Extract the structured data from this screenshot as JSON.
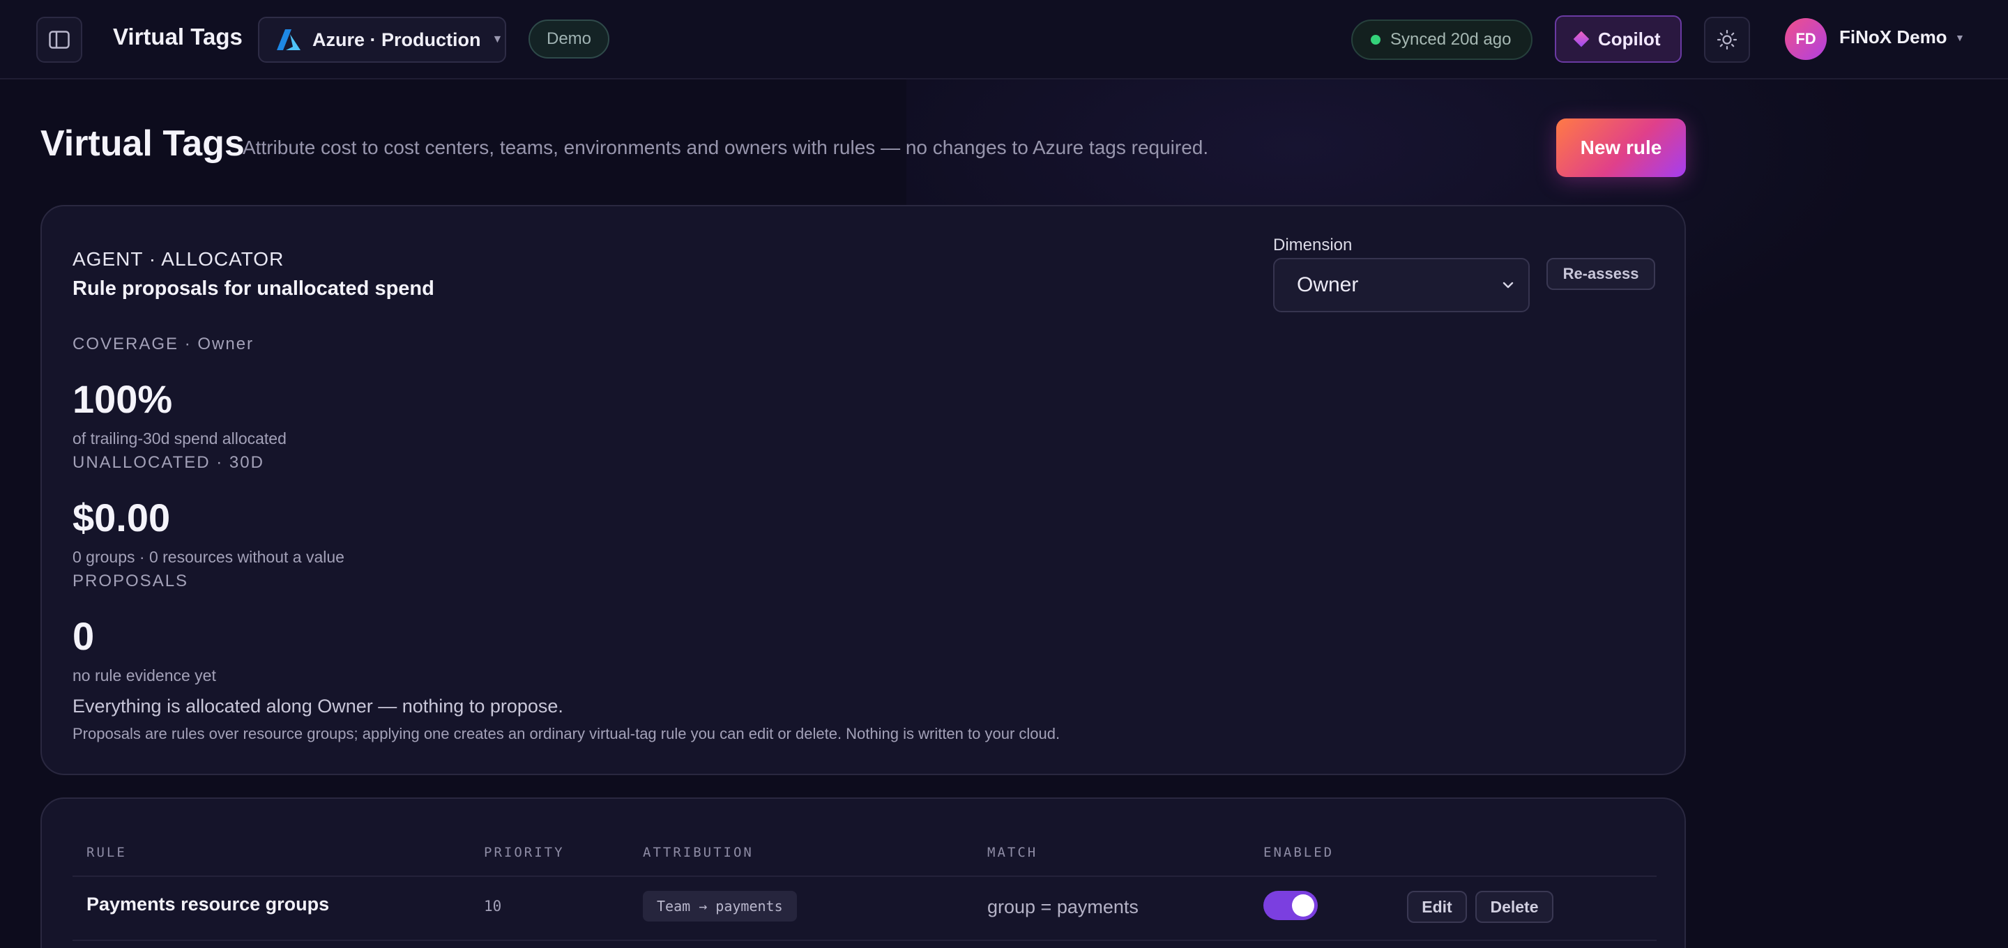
{
  "topbar": {
    "app_title": "Virtual Tags",
    "account_name": "Azure · Production",
    "demo_label": "Demo",
    "sync_status": "Synced 20d ago",
    "copilot_label": "Copilot",
    "user_initials": "FD",
    "user_name": "FiNoX Demo"
  },
  "header": {
    "title": "Virtual Tags",
    "subtitle": "Attribute cost to cost centers, teams, environments and owners with rules — no changes to Azure tags required.",
    "new_rule_label": "New rule"
  },
  "agent": {
    "kicker": "AGENT · ALLOCATOR",
    "title": "Rule proposals for unallocated spend",
    "dimension_label": "Dimension",
    "dimension_value": "Owner",
    "reassess_label": "Re-assess",
    "coverage_label": "COVERAGE · Owner",
    "coverage_value": "100%",
    "coverage_note": "of trailing-30d spend allocated",
    "unallocated_label": "UNALLOCATED · 30D",
    "unallocated_value": "$0.00",
    "unallocated_note": "0 groups · 0 resources without a value",
    "proposals_label": "PROPOSALS",
    "proposals_value": "0",
    "proposals_note": "no rule evidence yet",
    "message": "Everything is allocated along Owner — nothing to propose.",
    "footnote": "Proposals are rules over resource groups; applying one creates an ordinary virtual-tag rule you can edit or delete. Nothing is written to your cloud."
  },
  "table": {
    "columns": [
      "RULE",
      "PRIORITY",
      "ATTRIBUTION",
      "MATCH",
      "ENABLED"
    ],
    "rows": [
      {
        "rule": "Payments resource groups",
        "priority": "10",
        "attribution": "Team → payments",
        "match": "group = payments",
        "enabled": true,
        "edit_label": "Edit",
        "delete_label": "Delete"
      }
    ]
  },
  "colors": {
    "background": "#0d0c1d",
    "card": "#15142a",
    "accent_purple": "#7b3fe0",
    "accent_orange": "#ff7a45",
    "sync_dot": "#34d27a"
  },
  "icons": [
    "sidebar-toggle-icon",
    "azure-logo-icon",
    "chevron-down-icon",
    "sun-icon",
    "copilot-gem-icon"
  ]
}
